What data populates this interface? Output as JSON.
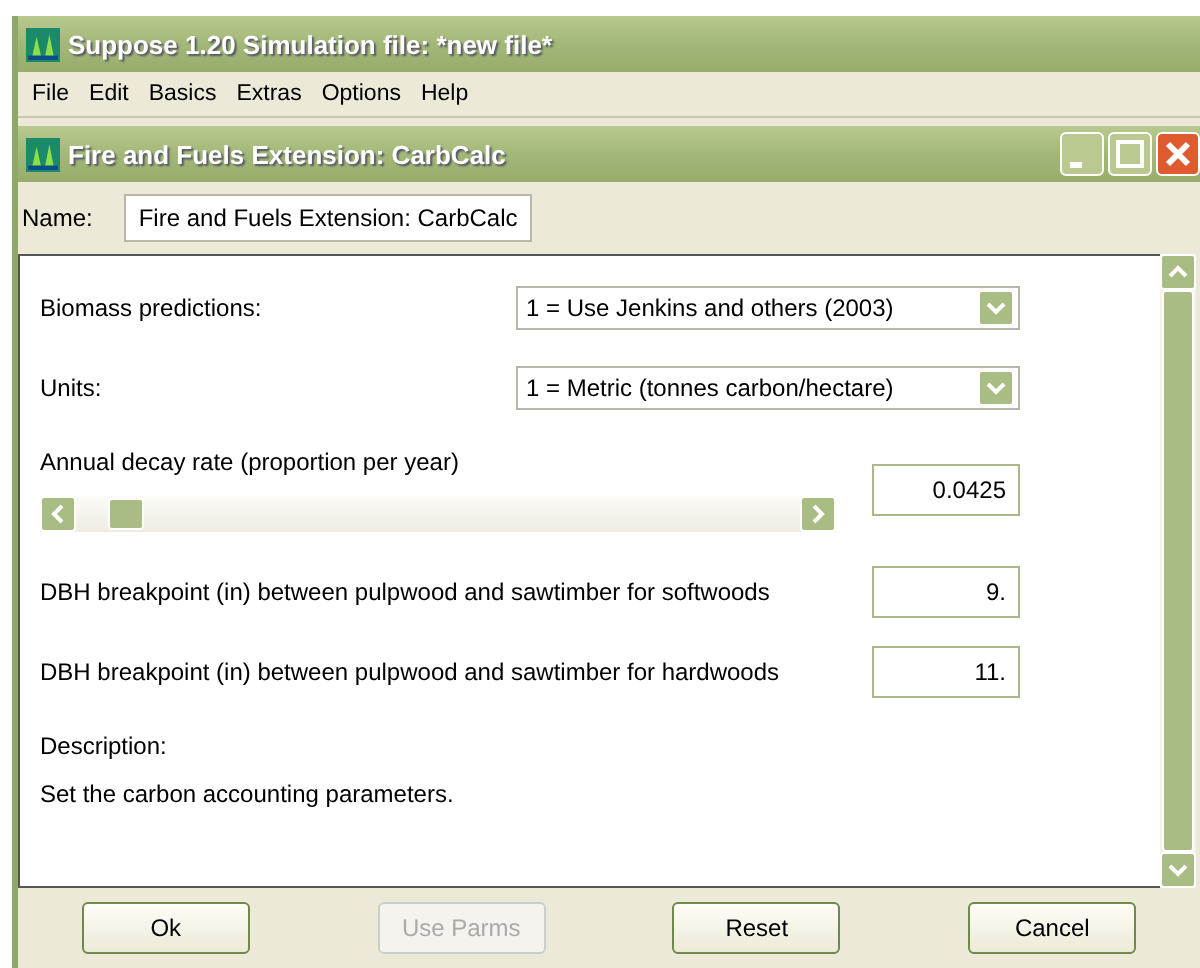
{
  "window": {
    "title": "Suppose 1.20  Simulation file:  *new file*"
  },
  "menu": [
    "File",
    "Edit",
    "Basics",
    "Extras",
    "Options",
    "Help"
  ],
  "dialog": {
    "title": "Fire and Fuels Extension: CarbCalc",
    "name_label": "Name:",
    "name_value": "Fire and Fuels Extension: CarbCalc",
    "params": [
      {
        "kind": "select",
        "label": "Biomass predictions:",
        "value": "1 = Use Jenkins and others (2003)"
      },
      {
        "kind": "select",
        "label": "Units:",
        "value": "1 = Metric (tonnes carbon/hectare)"
      },
      {
        "kind": "slider",
        "label": "Annual decay rate (proportion per year)",
        "level": 0.04,
        "value": "0.0425"
      },
      {
        "kind": "number",
        "label": "DBH breakpoint (in) between pulpwood and sawtimber for softwoods",
        "value": "9."
      },
      {
        "kind": "number",
        "label": "DBH breakpoint (in) between pulpwood and sawtimber for hardwoods",
        "value": "11."
      }
    ],
    "description_label": "Description:",
    "description": "Set the carbon accounting parameters.",
    "buttons": [
      {
        "label": "Ok",
        "disabled": false
      },
      {
        "label": "Use Parms",
        "disabled": true
      },
      {
        "label": "Reset",
        "disabled": false
      },
      {
        "label": "Cancel",
        "disabled": false
      }
    ]
  }
}
